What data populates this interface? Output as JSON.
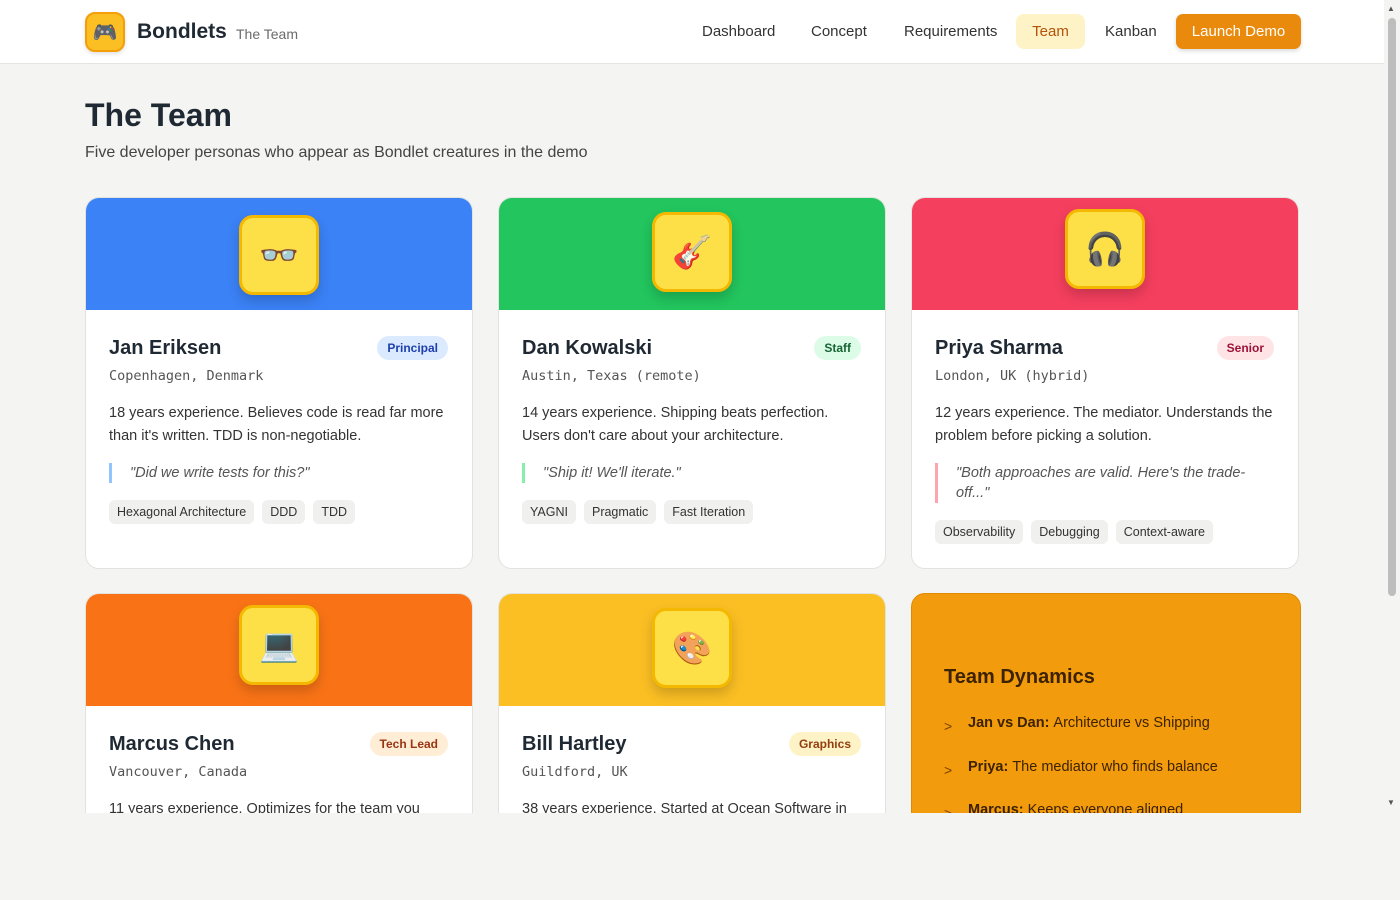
{
  "header": {
    "brand_name": "Bondlets",
    "brand_subtitle": "The Team",
    "logo_icon": "🎮",
    "nav": [
      {
        "label": "Dashboard",
        "active": false
      },
      {
        "label": "Concept",
        "active": false
      },
      {
        "label": "Requirements",
        "active": false
      },
      {
        "label": "Team",
        "active": true
      },
      {
        "label": "Kanban",
        "active": false
      }
    ],
    "launch_label": "Launch Demo"
  },
  "page": {
    "title": "The Team",
    "subtitle": "Five developer personas who appear as Bondlet creatures in the demo"
  },
  "members": [
    {
      "name": "Jan Eriksen",
      "role": "Principal",
      "location": "Copenhagen, Denmark",
      "bio": "18 years experience. Believes code is read far more than it's written. TDD is non-negotiable.",
      "quote": "\"Did we write tests for this?\"",
      "tags": [
        "Hexagonal Architecture",
        "DDD",
        "TDD"
      ],
      "avatar": "👓",
      "banner_color": "#3b82f6",
      "badge_bg": "#dbeafe",
      "badge_fg": "#1e40af",
      "quote_border": "#93c5fd"
    },
    {
      "name": "Dan Kowalski",
      "role": "Staff",
      "location": "Austin, Texas (remote)",
      "bio": "14 years experience. Shipping beats perfection. Users don't care about your architecture.",
      "quote": "\"Ship it! We'll iterate.\"",
      "tags": [
        "YAGNI",
        "Pragmatic",
        "Fast Iteration"
      ],
      "avatar": "🎸",
      "banner_color": "#22c55e",
      "badge_bg": "#dcfce7",
      "badge_fg": "#166534",
      "quote_border": "#86efac"
    },
    {
      "name": "Priya Sharma",
      "role": "Senior",
      "location": "London, UK (hybrid)",
      "bio": "12 years experience. The mediator. Understands the problem before picking a solution.",
      "quote": "\"Both approaches are valid. Here's the trade-off...\"",
      "tags": [
        "Observability",
        "Debugging",
        "Context-aware"
      ],
      "avatar": "🎧",
      "banner_color": "#f43f5e",
      "badge_bg": "#ffe4e6",
      "badge_fg": "#9f1239",
      "quote_border": "#fda4af"
    },
    {
      "name": "Marcus Chen",
      "role": "Tech Lead",
      "location": "Vancouver, Canada",
      "bio": "11 years experience. Optimizes for the team you",
      "avatar": "💻",
      "banner_color": "#f97316",
      "badge_bg": "#ffedd5",
      "badge_fg": "#9a3412"
    },
    {
      "name": "Bill Hartley",
      "role": "Graphics",
      "location": "Guildford, UK",
      "bio": "38 years experience. Started at Ocean Software in",
      "avatar": "🎨",
      "banner_color": "#fbbf24",
      "badge_bg": "#fef3c7",
      "badge_fg": "#92400e"
    }
  ],
  "dynamics": {
    "title": "Team Dynamics",
    "items": [
      {
        "who": "Jan vs Dan:",
        "text": "Architecture vs Shipping"
      },
      {
        "who": "Priya:",
        "text": "The mediator who finds balance"
      },
      {
        "who": "Marcus:",
        "text": "Keeps everyone aligned"
      }
    ]
  }
}
